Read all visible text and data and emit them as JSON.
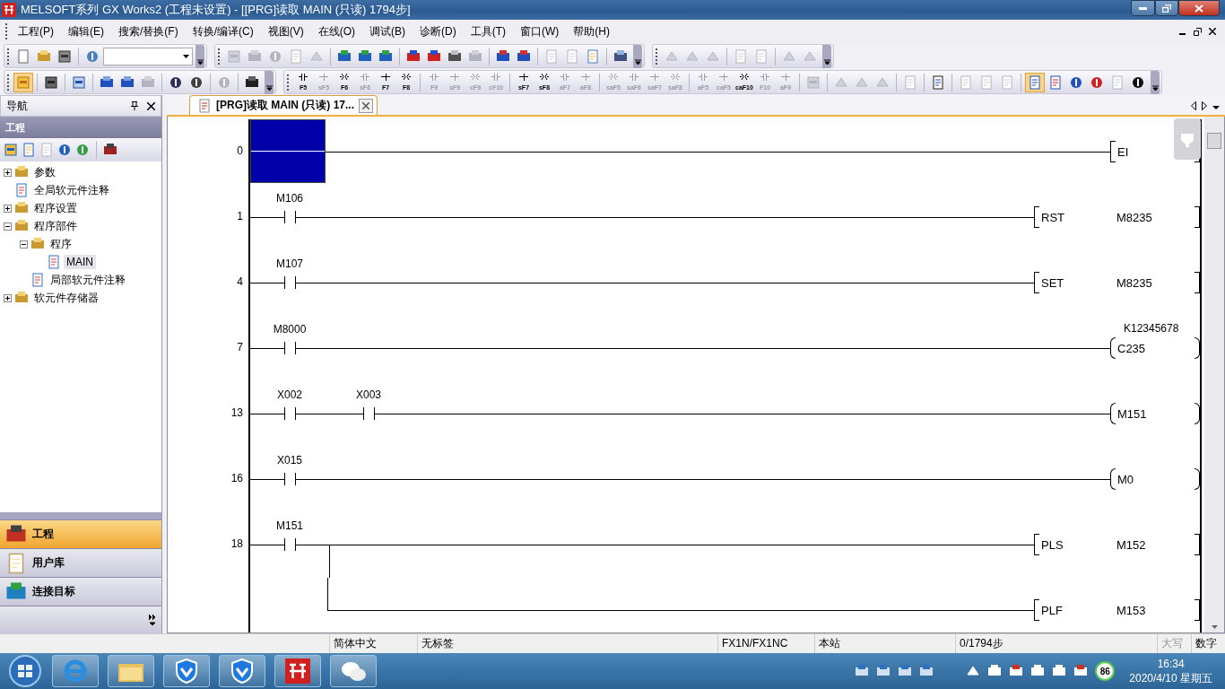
{
  "window": {
    "title": "MELSOFT系列 GX Works2 (工程未设置) - [[PRG]读取 MAIN (只读) 1794步]"
  },
  "menu": [
    "工程(P)",
    "编辑(E)",
    "搜索/替换(F)",
    "转换/编译(C)",
    "视图(V)",
    "在线(O)",
    "调试(B)",
    "诊断(D)",
    "工具(T)",
    "窗口(W)",
    "帮助(H)"
  ],
  "toolbar_keys": [
    {
      "key": "F5",
      "disabled": false
    },
    {
      "key": "sF5",
      "disabled": true
    },
    {
      "key": "F6",
      "disabled": false
    },
    {
      "key": "sF6",
      "disabled": true
    },
    {
      "key": "F7",
      "disabled": false
    },
    {
      "key": "F8",
      "disabled": false
    },
    {
      "key": "F9",
      "disabled": true
    },
    {
      "key": "sF9",
      "disabled": true
    },
    {
      "key": "cF9",
      "disabled": true
    },
    {
      "key": "cF10",
      "disabled": true
    },
    {
      "key": "sF7",
      "disabled": false
    },
    {
      "key": "sF8",
      "disabled": false
    },
    {
      "key": "aF7",
      "disabled": true
    },
    {
      "key": "aF8",
      "disabled": true
    },
    {
      "key": "saF5",
      "disabled": true
    },
    {
      "key": "saF6",
      "disabled": true
    },
    {
      "key": "saF7",
      "disabled": true
    },
    {
      "key": "saF8",
      "disabled": true
    },
    {
      "key": "aF5",
      "disabled": true
    },
    {
      "key": "caF5",
      "disabled": true
    },
    {
      "key": "caF10",
      "disabled": false
    },
    {
      "key": "F10",
      "disabled": true
    },
    {
      "key": "aF9",
      "disabled": true
    }
  ],
  "navigator": {
    "title": "导航",
    "section": "工程",
    "tree": [
      {
        "label": "参数",
        "expanded": false,
        "selected": false
      },
      {
        "label": "全局软元件注释",
        "selected": false
      },
      {
        "label": "程序设置",
        "expanded": false,
        "selected": false
      },
      {
        "label": "程序部件",
        "expanded": true,
        "selected": false,
        "children": [
          {
            "label": "程序",
            "expanded": true,
            "selected": false,
            "children": [
              {
                "label": "MAIN",
                "selected": true
              }
            ]
          },
          {
            "label": "局部软元件注释",
            "selected": false
          }
        ]
      },
      {
        "label": "软元件存储器",
        "expanded": false,
        "selected": false
      }
    ],
    "buttons": [
      {
        "label": "工程",
        "selected": true
      },
      {
        "label": "用户库",
        "selected": false
      },
      {
        "label": "连接目标",
        "selected": false
      }
    ]
  },
  "tab": {
    "label": "[PRG]读取 MAIN (只读) 17..."
  },
  "ladder": {
    "rungs": [
      {
        "step": "0",
        "cursor": true,
        "outputs": [
          {
            "kind": "instruction",
            "op": "EI"
          }
        ]
      },
      {
        "step": "1",
        "cursor": false,
        "contacts": [
          {
            "label": "M106"
          }
        ],
        "outputs": [
          {
            "kind": "instruction",
            "op": "RST",
            "operand": "M8235"
          }
        ]
      },
      {
        "step": "4",
        "cursor": false,
        "contacts": [
          {
            "label": "M107"
          }
        ],
        "outputs": [
          {
            "kind": "instruction",
            "op": "SET",
            "operand": "M8235"
          }
        ]
      },
      {
        "step": "7",
        "cursor": false,
        "contacts": [
          {
            "label": "M8000"
          }
        ],
        "outputs": [
          {
            "kind": "coil",
            "op": "C235",
            "label": "K12345678"
          }
        ]
      },
      {
        "step": "13",
        "cursor": false,
        "contacts": [
          {
            "label": "X002"
          },
          {
            "label": "X003"
          }
        ],
        "outputs": [
          {
            "kind": "coil",
            "op": "M151"
          }
        ]
      },
      {
        "step": "16",
        "cursor": false,
        "contacts": [
          {
            "label": "X015"
          }
        ],
        "outputs": [
          {
            "kind": "coil",
            "op": "M0"
          }
        ]
      },
      {
        "step": "18",
        "cursor": false,
        "contacts": [
          {
            "label": "M151"
          }
        ],
        "outputs": [
          {
            "kind": "instruction",
            "op": "PLS",
            "operand": "M152"
          },
          {
            "kind": "instruction",
            "op": "PLF",
            "operand": "M153"
          }
        ]
      }
    ]
  },
  "status_bar": [
    {
      "text": "简体中文",
      "disabled": false
    },
    {
      "text": "无标签",
      "disabled": false
    },
    {
      "text": "FX1N/FX1NC",
      "disabled": false
    },
    {
      "text": "本站",
      "disabled": false
    },
    {
      "text": "0/1794步",
      "disabled": false
    },
    {
      "text": "大写",
      "disabled": true
    },
    {
      "text": "数字",
      "disabled": false
    }
  ],
  "taskbar": {
    "badge": "86",
    "time": "16:34",
    "date": "2020/4/10 星期五"
  }
}
